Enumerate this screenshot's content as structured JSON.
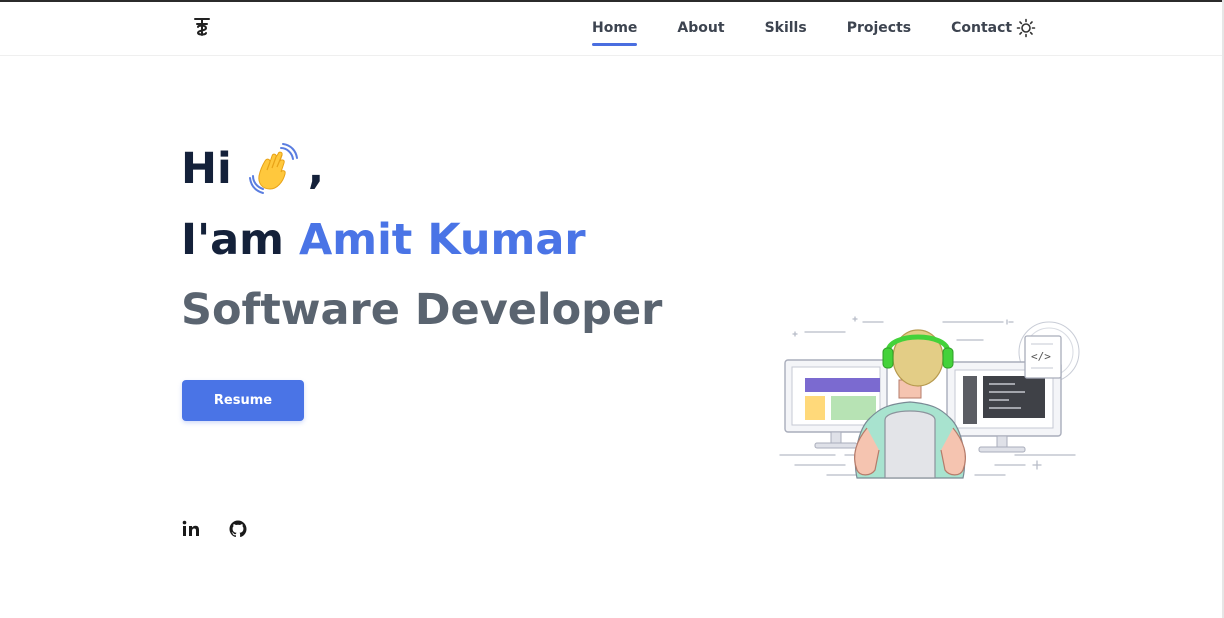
{
  "nav": {
    "logo_icon": "ts-monogram-logo",
    "links": [
      {
        "label": "Home",
        "active": true
      },
      {
        "label": "About",
        "active": false
      },
      {
        "label": "Skills",
        "active": false
      },
      {
        "label": "Projects",
        "active": false
      },
      {
        "label": "Contact",
        "active": false
      }
    ],
    "theme_toggle_icon": "sun-icon"
  },
  "hero": {
    "greeting": "Hi",
    "greeting_emoji": "waving-hand",
    "greeting_suffix": ",",
    "intro_prefix": "I'am",
    "name": "Amit Kumar",
    "role": "Software Developer",
    "resume_label": "Resume",
    "illustration": "developer-at-desk-with-headphones"
  },
  "social": [
    "linkedin-icon",
    "github-icon"
  ],
  "colors": {
    "accent": "#4a74e6",
    "heading": "#14213a",
    "role_text": "#5a6470",
    "nav_text": "#3d4450",
    "headphones": "#44d23a"
  }
}
